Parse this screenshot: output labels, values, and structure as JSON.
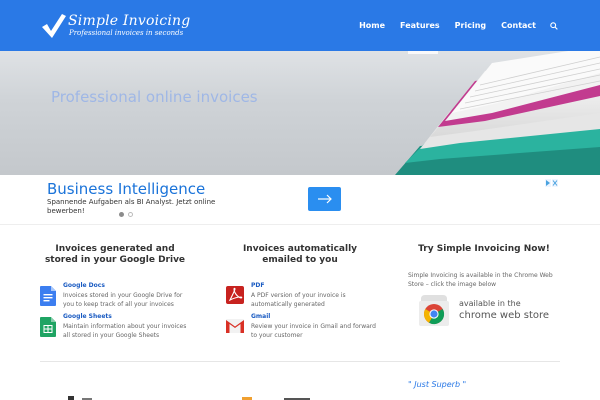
{
  "header": {
    "logo_title": "Simple Invoicing",
    "logo_tagline": "Professional invoices in seconds",
    "nav": [
      "Home",
      "Features",
      "Pricing",
      "Contact"
    ],
    "accent": "#2a79e6"
  },
  "hero": {
    "title": "Professional online invoices"
  },
  "ad": {
    "title": "Business Intelligence",
    "text": "Spannende Aufgaben als BI Analyst. Jetzt online bewerben!",
    "button_icon": "arrow-right-icon",
    "active_slide": 0,
    "slide_count": 2
  },
  "columns": [
    {
      "title": "Invoices generated and stored in your Google Drive",
      "features": [
        {
          "icon": "google-docs-icon",
          "name": "Google Docs",
          "desc": "Invoices stored in your Google Drive for you to keep track of all your invoices"
        },
        {
          "icon": "google-sheets-icon",
          "name": "Google Sheets",
          "desc": "Maintain information about your invoices all stored in your Google Sheets"
        }
      ]
    },
    {
      "title": "Invoices automatically emailed to you",
      "features": [
        {
          "icon": "pdf-icon",
          "name": "PDF",
          "desc": "A PDF version of your invoice is automatically generated"
        },
        {
          "icon": "gmail-icon",
          "name": "Gmail",
          "desc": "Review your invoice in Gmail and forward to your customer"
        }
      ]
    },
    {
      "title": "Try Simple Invoicing Now!",
      "text": "Simple Invoicing is available in the Chrome Web Store – click the image below",
      "badge_line1": "available in the",
      "badge_line2": "chrome web store"
    }
  ],
  "testimonial": {
    "quote": "\" Just Superb \""
  }
}
